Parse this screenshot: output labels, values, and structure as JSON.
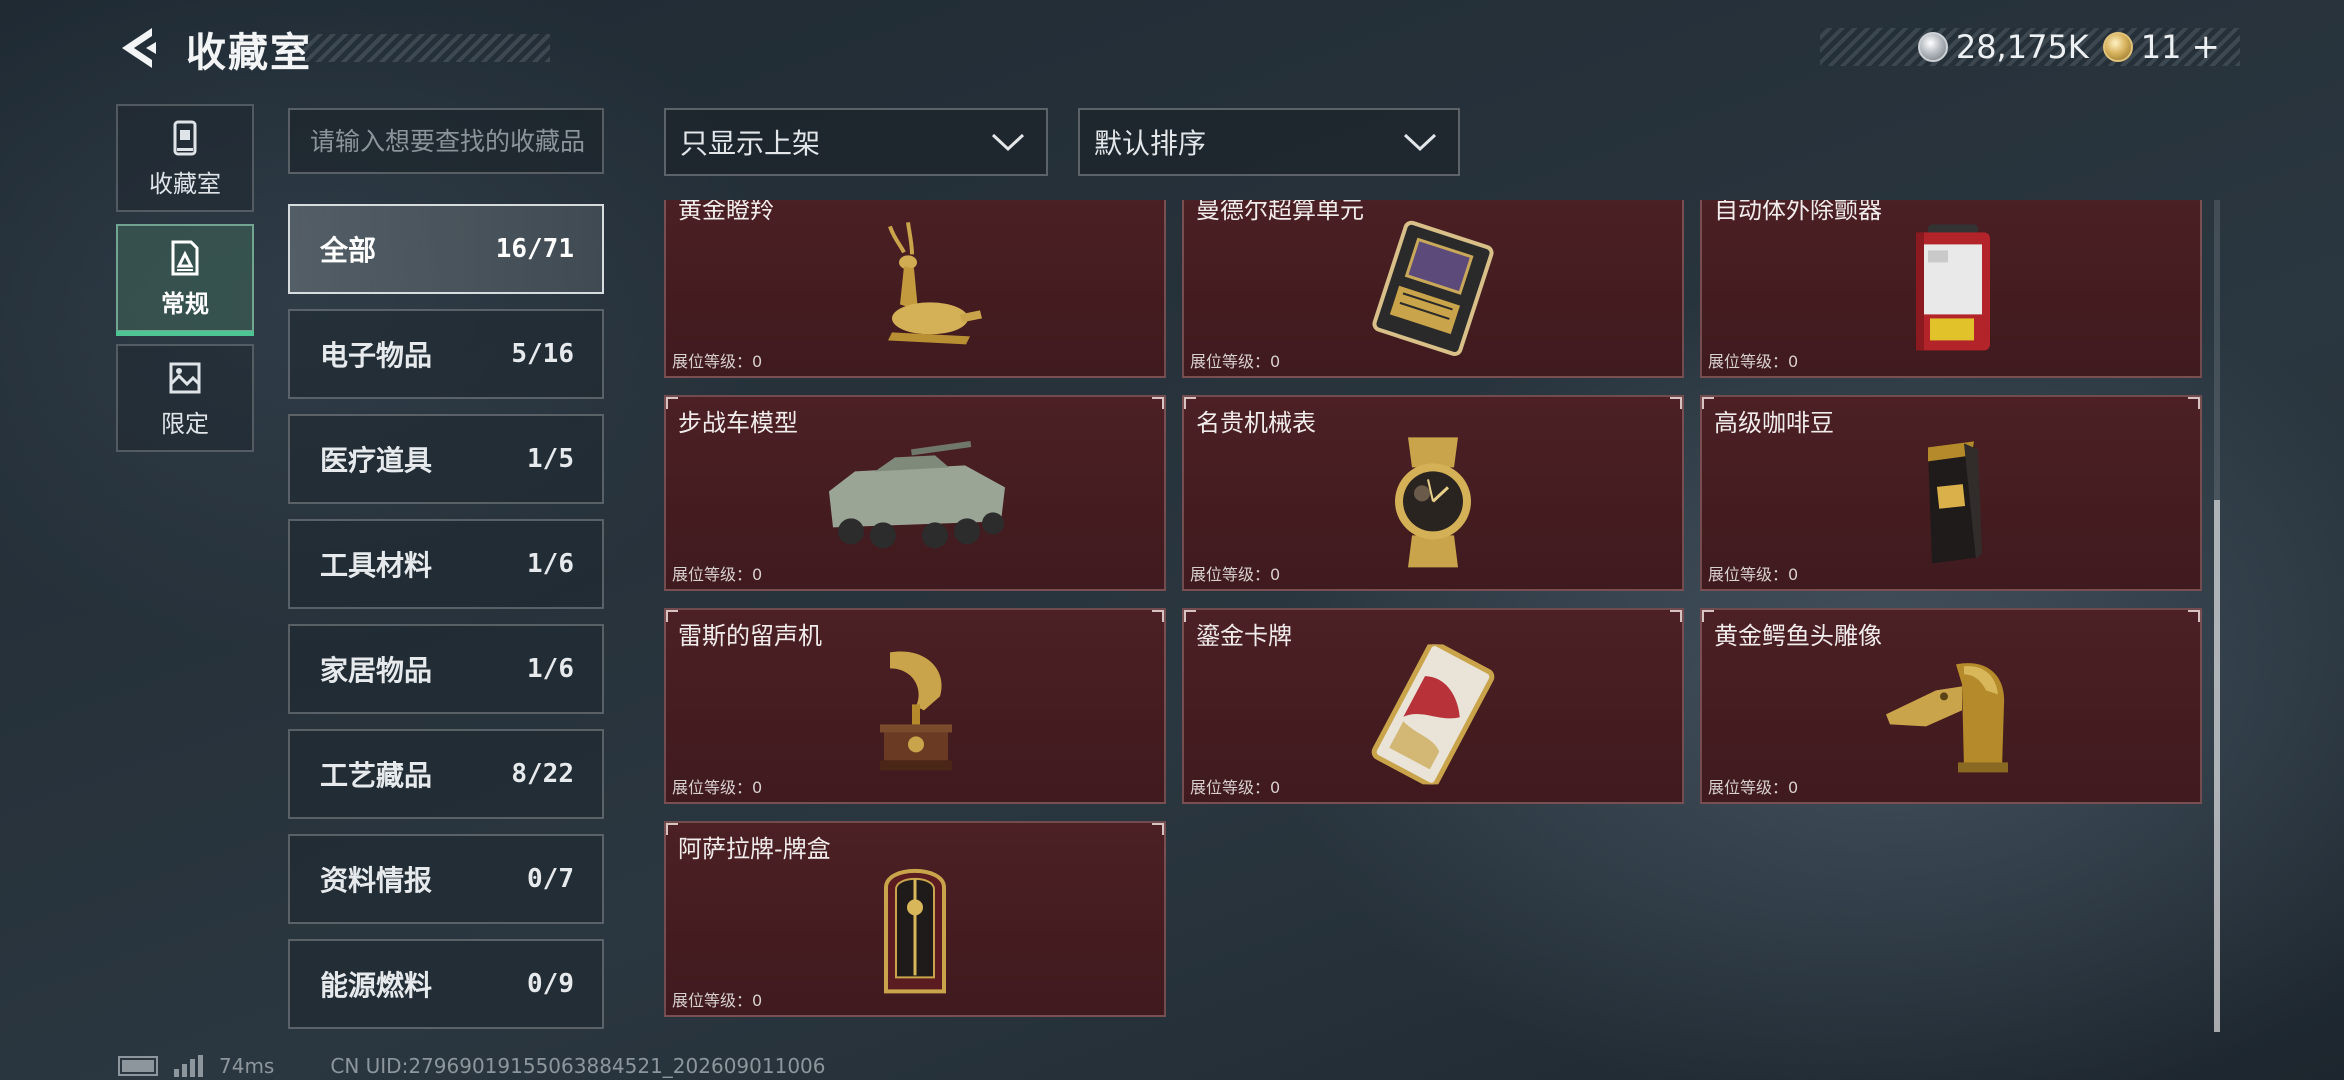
{
  "header": {
    "title": "收藏室",
    "currencies": [
      {
        "icon": "silver-coin-icon",
        "value": "28,175K"
      },
      {
        "icon": "gold-coin-icon",
        "value": "11"
      }
    ],
    "add_label": "+"
  },
  "side_tabs": [
    {
      "label": "收藏室",
      "icon": "collection-room-icon",
      "active": false
    },
    {
      "label": "常规",
      "icon": "regular-items-icon",
      "active": true
    },
    {
      "label": "限定",
      "icon": "limited-items-icon",
      "active": false
    }
  ],
  "search": {
    "placeholder": "请输入想要查找的收藏品"
  },
  "categories": [
    {
      "name": "全部",
      "count": "16/71",
      "active": true
    },
    {
      "name": "电子物品",
      "count": "5/16"
    },
    {
      "name": "医疗道具",
      "count": "1/5"
    },
    {
      "name": "工具材料",
      "count": "1/6"
    },
    {
      "name": "家居物品",
      "count": "1/6"
    },
    {
      "name": "工艺藏品",
      "count": "8/22"
    },
    {
      "name": "资料情报",
      "count": "0/7"
    },
    {
      "name": "能源燃料",
      "count": "0/9"
    }
  ],
  "filters": {
    "display_filter": "只显示上架",
    "sort": "默认排序"
  },
  "items": [
    {
      "name": "黄金瞪羚",
      "level": "展位等级：0",
      "icon": "golden-gazelle-icon"
    },
    {
      "name": "曼德尔超算单元",
      "level": "展位等级：0",
      "icon": "supercomputing-unit-icon"
    },
    {
      "name": "自动体外除颤器",
      "level": "展位等级：0",
      "icon": "defibrillator-icon"
    },
    {
      "name": "步战车模型",
      "level": "展位等级：0",
      "icon": "ifv-model-icon"
    },
    {
      "name": "名贵机械表",
      "level": "展位等级：0",
      "icon": "mechanical-watch-icon"
    },
    {
      "name": "高级咖啡豆",
      "level": "展位等级：0",
      "icon": "coffee-beans-icon"
    },
    {
      "name": "雷斯的留声机",
      "level": "展位等级：0",
      "icon": "gramophone-icon"
    },
    {
      "name": "鎏金卡牌",
      "level": "展位等级：0",
      "icon": "gilded-card-icon"
    },
    {
      "name": "黄金鳄鱼头雕像",
      "level": "展位等级：0",
      "icon": "gold-crocodile-statue-icon"
    },
    {
      "name": "阿萨拉牌-牌盒",
      "level": "展位等级：0",
      "icon": "card-box-icon"
    }
  ],
  "status": {
    "ping": "74ms",
    "uid": "CN UID:27969019155063884521_202609011006"
  }
}
